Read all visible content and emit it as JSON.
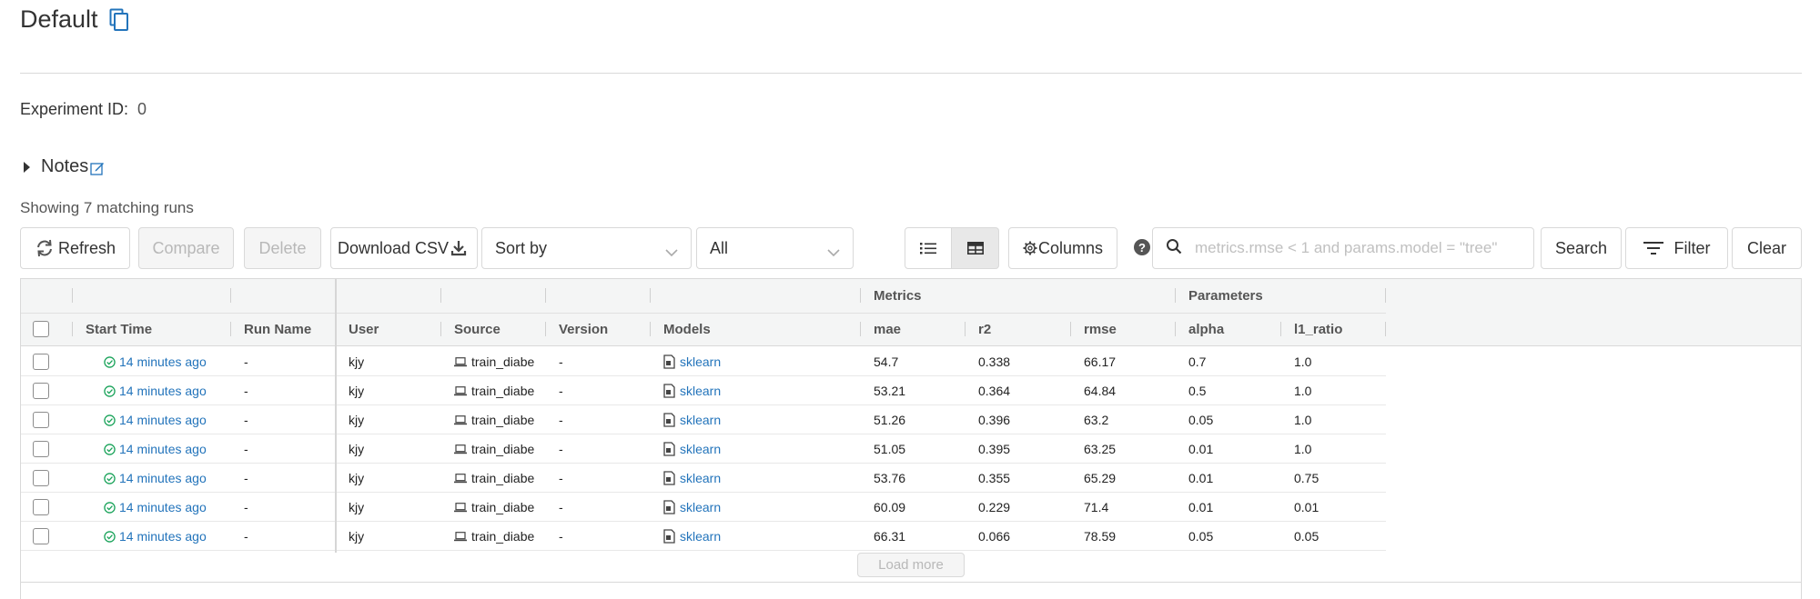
{
  "header": {
    "title": "Default",
    "experiment_id_label": "Experiment ID:",
    "experiment_id": "0",
    "notes_label": "Notes",
    "showing_text": "Showing 7 matching runs"
  },
  "toolbar": {
    "refresh_label": "Refresh",
    "compare_label": "Compare",
    "delete_label": "Delete",
    "download_label": "Download CSV",
    "sort_label": "Sort by",
    "filter_select_value": "All",
    "columns_label": "Columns",
    "search_placeholder": "metrics.rmse < 1 and params.model = \"tree\"",
    "search_label": "Search",
    "filter_label": "Filter",
    "clear_label": "Clear"
  },
  "table": {
    "groups": {
      "metrics": "Metrics",
      "parameters": "Parameters"
    },
    "columns": {
      "start_time": "Start Time",
      "run_name": "Run Name",
      "user": "User",
      "source": "Source",
      "version": "Version",
      "models": "Models",
      "mae": "mae",
      "r2": "r2",
      "rmse": "rmse",
      "alpha": "alpha",
      "l1_ratio": "l1_ratio"
    },
    "rows": [
      {
        "start_time": "14 minutes ago",
        "run_name": "-",
        "user": "kjy",
        "source": "train_diabe",
        "version": "-",
        "model": "sklearn",
        "mae": "54.7",
        "r2": "0.338",
        "rmse": "66.17",
        "alpha": "0.7",
        "l1_ratio": "1.0"
      },
      {
        "start_time": "14 minutes ago",
        "run_name": "-",
        "user": "kjy",
        "source": "train_diabe",
        "version": "-",
        "model": "sklearn",
        "mae": "53.21",
        "r2": "0.364",
        "rmse": "64.84",
        "alpha": "0.5",
        "l1_ratio": "1.0"
      },
      {
        "start_time": "14 minutes ago",
        "run_name": "-",
        "user": "kjy",
        "source": "train_diabe",
        "version": "-",
        "model": "sklearn",
        "mae": "51.26",
        "r2": "0.396",
        "rmse": "63.2",
        "alpha": "0.05",
        "l1_ratio": "1.0"
      },
      {
        "start_time": "14 minutes ago",
        "run_name": "-",
        "user": "kjy",
        "source": "train_diabe",
        "version": "-",
        "model": "sklearn",
        "mae": "51.05",
        "r2": "0.395",
        "rmse": "63.25",
        "alpha": "0.01",
        "l1_ratio": "1.0"
      },
      {
        "start_time": "14 minutes ago",
        "run_name": "-",
        "user": "kjy",
        "source": "train_diabe",
        "version": "-",
        "model": "sklearn",
        "mae": "53.76",
        "r2": "0.355",
        "rmse": "65.29",
        "alpha": "0.01",
        "l1_ratio": "0.75"
      },
      {
        "start_time": "14 minutes ago",
        "run_name": "-",
        "user": "kjy",
        "source": "train_diabe",
        "version": "-",
        "model": "sklearn",
        "mae": "60.09",
        "r2": "0.229",
        "rmse": "71.4",
        "alpha": "0.01",
        "l1_ratio": "0.01"
      },
      {
        "start_time": "14 minutes ago",
        "run_name": "-",
        "user": "kjy",
        "source": "train_diabe",
        "version": "-",
        "model": "sklearn",
        "mae": "66.31",
        "r2": "0.066",
        "rmse": "78.59",
        "alpha": "0.05",
        "l1_ratio": "0.05"
      }
    ],
    "load_more_label": "Load more"
  },
  "colors": {
    "link": "#2374bb",
    "success": "#1aa35a",
    "header_bg": "#f4f5f5",
    "border": "#d9d9d9"
  }
}
